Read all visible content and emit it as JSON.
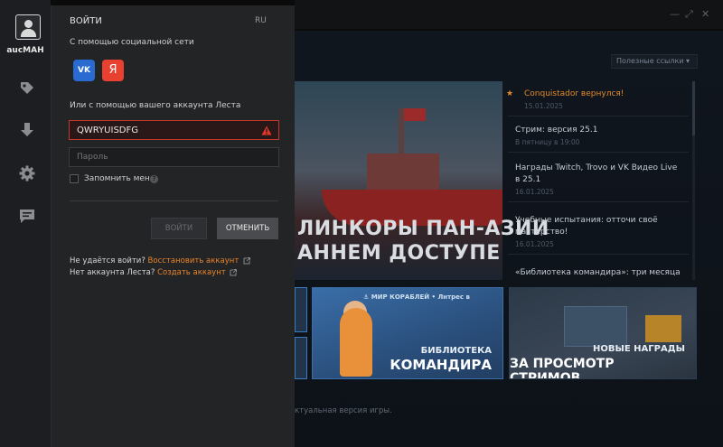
{
  "background": {
    "quick_links": "Полезные ссылки ▾",
    "banner": {
      "line1": "ЛИНКОРЫ ПАН-АЗИИ",
      "line2": "АННЕМ ДОСТУПЕ"
    },
    "news": [
      {
        "title": "Conquistador вернулся!",
        "date": "15.01.2025",
        "highlight": true
      },
      {
        "title": "Стрим: версия 25.1",
        "date": "В пятницу в 19:00",
        "highlight": false
      },
      {
        "title": "Награды Twitch, Trovo и VK Видео Live в 25.1",
        "date": "16.01.2025",
        "highlight": false
      },
      {
        "title": "Учебные испытания: отточи своё мастерство!",
        "date": "16.01.2025",
        "highlight": false
      },
      {
        "title": "«Библиотека командира»: три месяца",
        "date": "",
        "highlight": false
      }
    ],
    "tile_library": {
      "brand": "⚓ МИР КОРАБЛЕЙ  •  Лнтрес в",
      "line1": "БИБЛИОТЕКА",
      "line2": "КОМАНДИРА"
    },
    "tile_streams": {
      "line1": "НОВЫЕ НАГРАДЫ",
      "line2": "ЗА ПРОСМОТР СТРИМОВ"
    },
    "status_text": "ктуальная версия игры."
  },
  "sidebar": {
    "username": "aucMAH",
    "icons": [
      "shop-icon",
      "download-icon",
      "settings-icon",
      "chat-icon"
    ]
  },
  "login": {
    "title": "ВОЙТИ",
    "lang": "RU",
    "social_label": "С помощью социальной сети",
    "vk_label": "VK",
    "ya_label": "Я",
    "account_label": "Или с помощью вашего аккаунта Леста",
    "login_value": "QWRYUISDFG",
    "password_placeholder": "Пароль",
    "remember_label": "Запомнить меня",
    "help_label": "?",
    "login_button": "ВОЙТИ",
    "cancel_button": "ОТМЕНИТЬ",
    "recover_prefix": "Не удаётся войти?",
    "recover_link": "Восстановить аккаунт",
    "create_prefix": "Нет аккаунта Леста?",
    "create_link": "Создать аккаунт"
  },
  "colors": {
    "accent_orange": "#e8852a",
    "error_red": "#c0392b",
    "vk_blue": "#2a6bd1",
    "yandex_red": "#e8412f"
  }
}
